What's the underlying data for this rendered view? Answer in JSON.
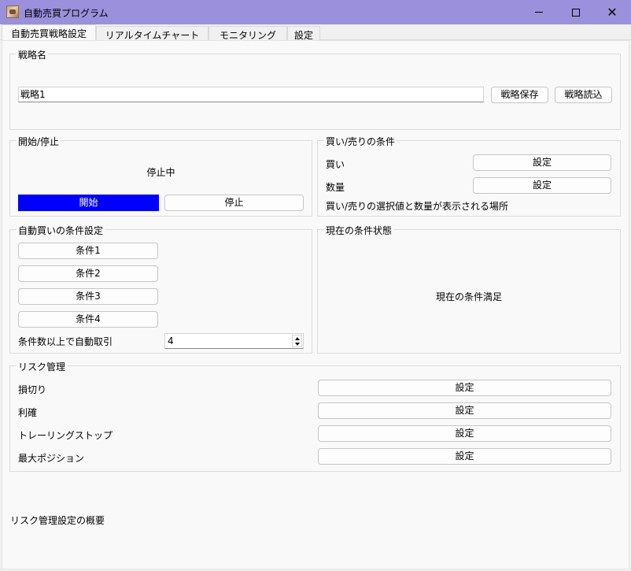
{
  "window": {
    "title": "自動売買プログラム",
    "icon": "app-icon",
    "controls": [
      "minimize-icon",
      "maximize-icon",
      "close-icon"
    ],
    "close_glyph": "✕"
  },
  "tabs": [
    {
      "label": "自動売買戦略設定",
      "active": true
    },
    {
      "label": "リアルタイムチャート",
      "active": false
    },
    {
      "label": "モニタリング",
      "active": false
    },
    {
      "label": "設定",
      "active": false
    }
  ],
  "strategy": {
    "group_title": "戦略名",
    "name_value": "戦略1",
    "save_label": "戦略保存",
    "load_label": "戦略読込"
  },
  "start_stop": {
    "group_title": "開始/停止",
    "status": "停止中",
    "start_label": "開始",
    "stop_label": "停止",
    "start_color": "#0000ff"
  },
  "buy_sell": {
    "group_title": "買い/売りの条件",
    "buy_label": "買い",
    "buy_button": "設定",
    "quantity_label": "数量",
    "quantity_button": "設定",
    "display_text": "買い/売りの選択値と数量が表示される場所"
  },
  "auto_buy": {
    "group_title": "自動買いの条件設定",
    "conditions": [
      "条件1",
      "条件2",
      "条件3",
      "条件4"
    ],
    "threshold_label": "条件数以上で自動取引",
    "threshold_value": "4"
  },
  "current_status": {
    "group_title": "現在の条件状態",
    "text": "現在の条件満足"
  },
  "risk": {
    "group_title": "リスク管理",
    "items": [
      {
        "label": "損切り",
        "button": "設定"
      },
      {
        "label": "利確",
        "button": "設定"
      },
      {
        "label": "トレーリングストップ",
        "button": "設定"
      },
      {
        "label": "最大ポジション",
        "button": "設定"
      }
    ],
    "summary": "リスク管理設定の概要"
  },
  "colors": {
    "titlebar": "#9a90dc",
    "start_button": "#0000ff"
  }
}
